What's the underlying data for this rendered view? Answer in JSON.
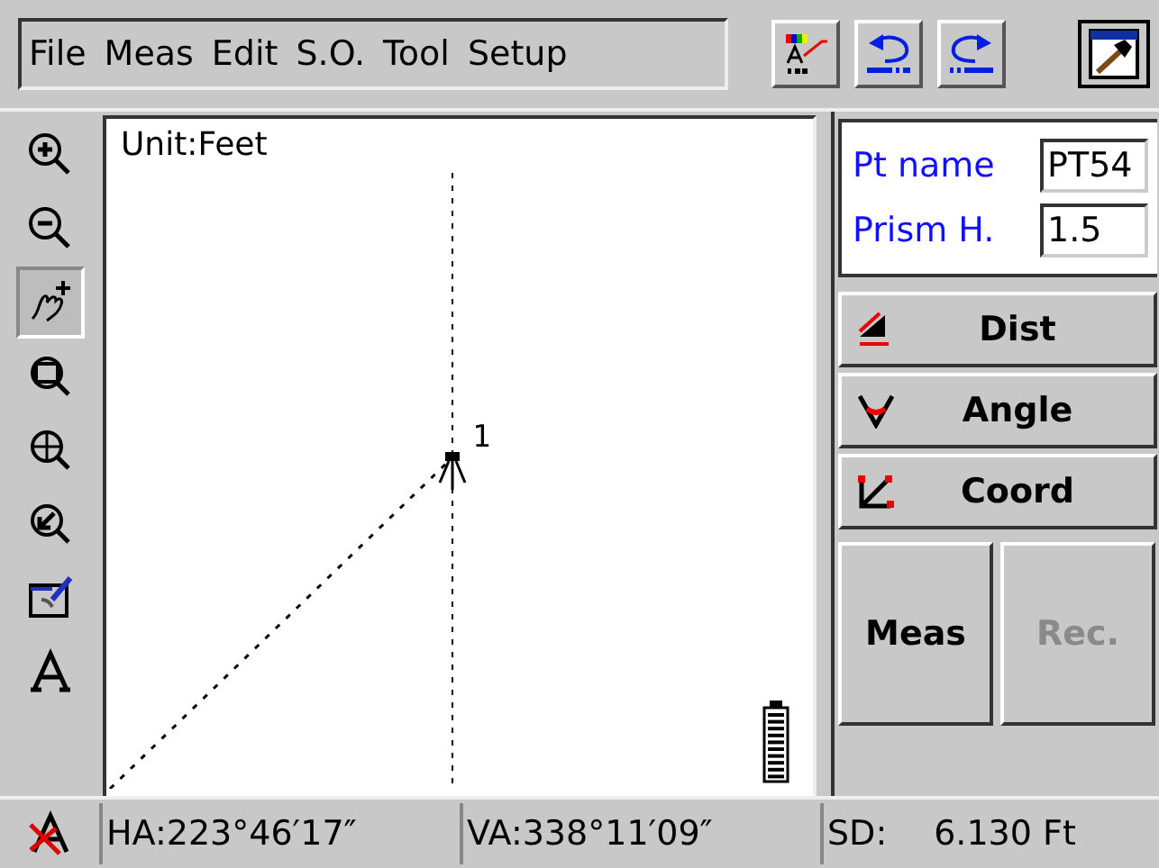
{
  "menu": [
    "File",
    "Meas",
    "Edit",
    "S.O.",
    "Tool",
    "Setup"
  ],
  "toolbar": [
    {
      "kind": "layers"
    },
    {
      "kind": "undo"
    },
    {
      "kind": "redo"
    }
  ],
  "tools": [
    {
      "kind": "zoom-in",
      "selected": false
    },
    {
      "kind": "zoom-out",
      "selected": false
    },
    {
      "kind": "pan",
      "selected": true
    },
    {
      "kind": "zoom-window",
      "selected": false
    },
    {
      "kind": "zoom-all",
      "selected": false
    },
    {
      "kind": "zoom-point",
      "selected": false
    },
    {
      "kind": "edit",
      "selected": false
    },
    {
      "kind": "text",
      "selected": false
    },
    {
      "kind": "text-off",
      "selected": false
    }
  ],
  "canvas": {
    "unit": "Unit:Feet",
    "point_label": "1"
  },
  "fields": [
    {
      "label": "Pt name",
      "value": "PT54"
    },
    {
      "label": "Prism H.",
      "value": "1.5"
    }
  ],
  "modes": [
    {
      "kind": "dist",
      "label": "Dist"
    },
    {
      "kind": "angle",
      "label": "Angle"
    },
    {
      "kind": "coord",
      "label": "Coord"
    }
  ],
  "actions": [
    {
      "label": "Meas",
      "disabled": false
    },
    {
      "label": "Rec.",
      "disabled": true
    }
  ],
  "status": {
    "ha": "HA:223°46′17″",
    "va": "VA:338°11′09″",
    "sd_label": "SD:",
    "sd_value": "6.130 Ft"
  }
}
